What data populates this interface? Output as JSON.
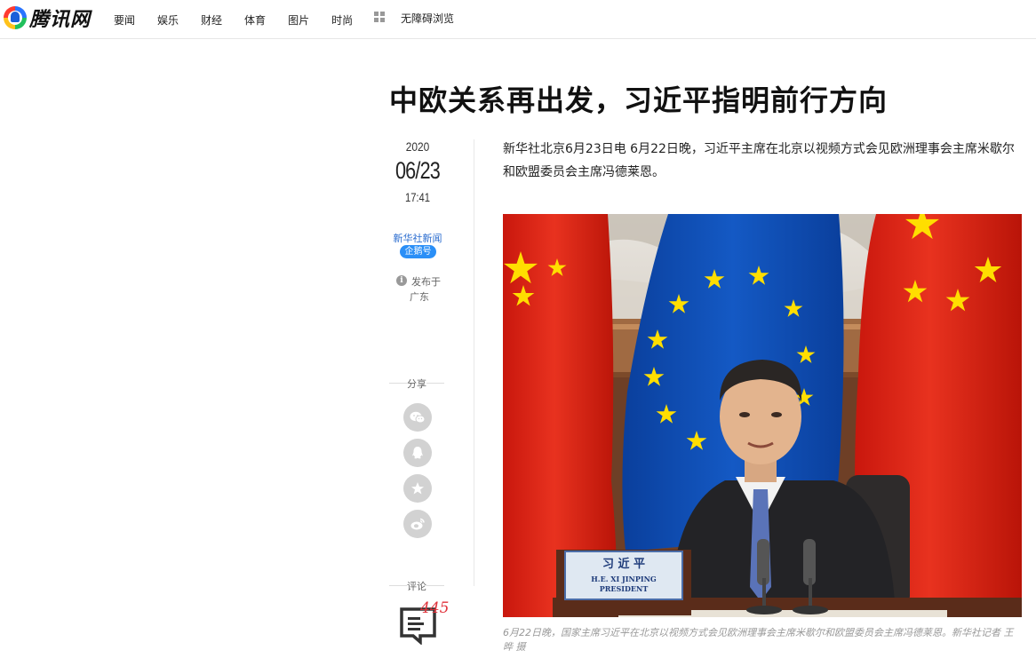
{
  "brand": {
    "logo_text": "腾讯网"
  },
  "nav": {
    "items": [
      "要闻",
      "娱乐",
      "财经",
      "体育",
      "图片",
      "时尚"
    ],
    "accessibility_label": "无障碍浏览"
  },
  "article": {
    "title": "中欧关系再出发，习近平指明前行方向",
    "date": {
      "year": "2020",
      "month_day": "06/23",
      "time": "17:41"
    },
    "source": {
      "name": "新华社新闻",
      "badge": "企鹅号"
    },
    "published": {
      "label": "发布于",
      "region": "广东"
    },
    "lead": "新华社北京6月23日电 6月22日晚，习近平主席在北京以视频方式会见欧洲理事会主席米歇尔和欧盟委员会主席冯德莱恩。",
    "photo": {
      "nameplate_cn": "习 近 平",
      "nameplate_en_1": "H.E. XI JINPING",
      "nameplate_en_2": "PRESIDENT"
    },
    "caption": "6月22日晚，国家主席习近平在北京以视频方式会见欧洲理事会主席米歇尔和欧盟委员会主席冯德莱恩。新华社记者 王晔 摄"
  },
  "share": {
    "label": "分享",
    "icons": [
      "wechat-icon",
      "qq-icon",
      "qzone-icon",
      "weibo-icon"
    ]
  },
  "comments": {
    "label": "评论",
    "count": "445"
  },
  "colors": {
    "accent_blue": "#2a8ff7",
    "comment_red": "#e0313a",
    "flag_red": "#de2910",
    "eu_blue": "#0e4fb3",
    "star_yellow": "#ffde00"
  }
}
